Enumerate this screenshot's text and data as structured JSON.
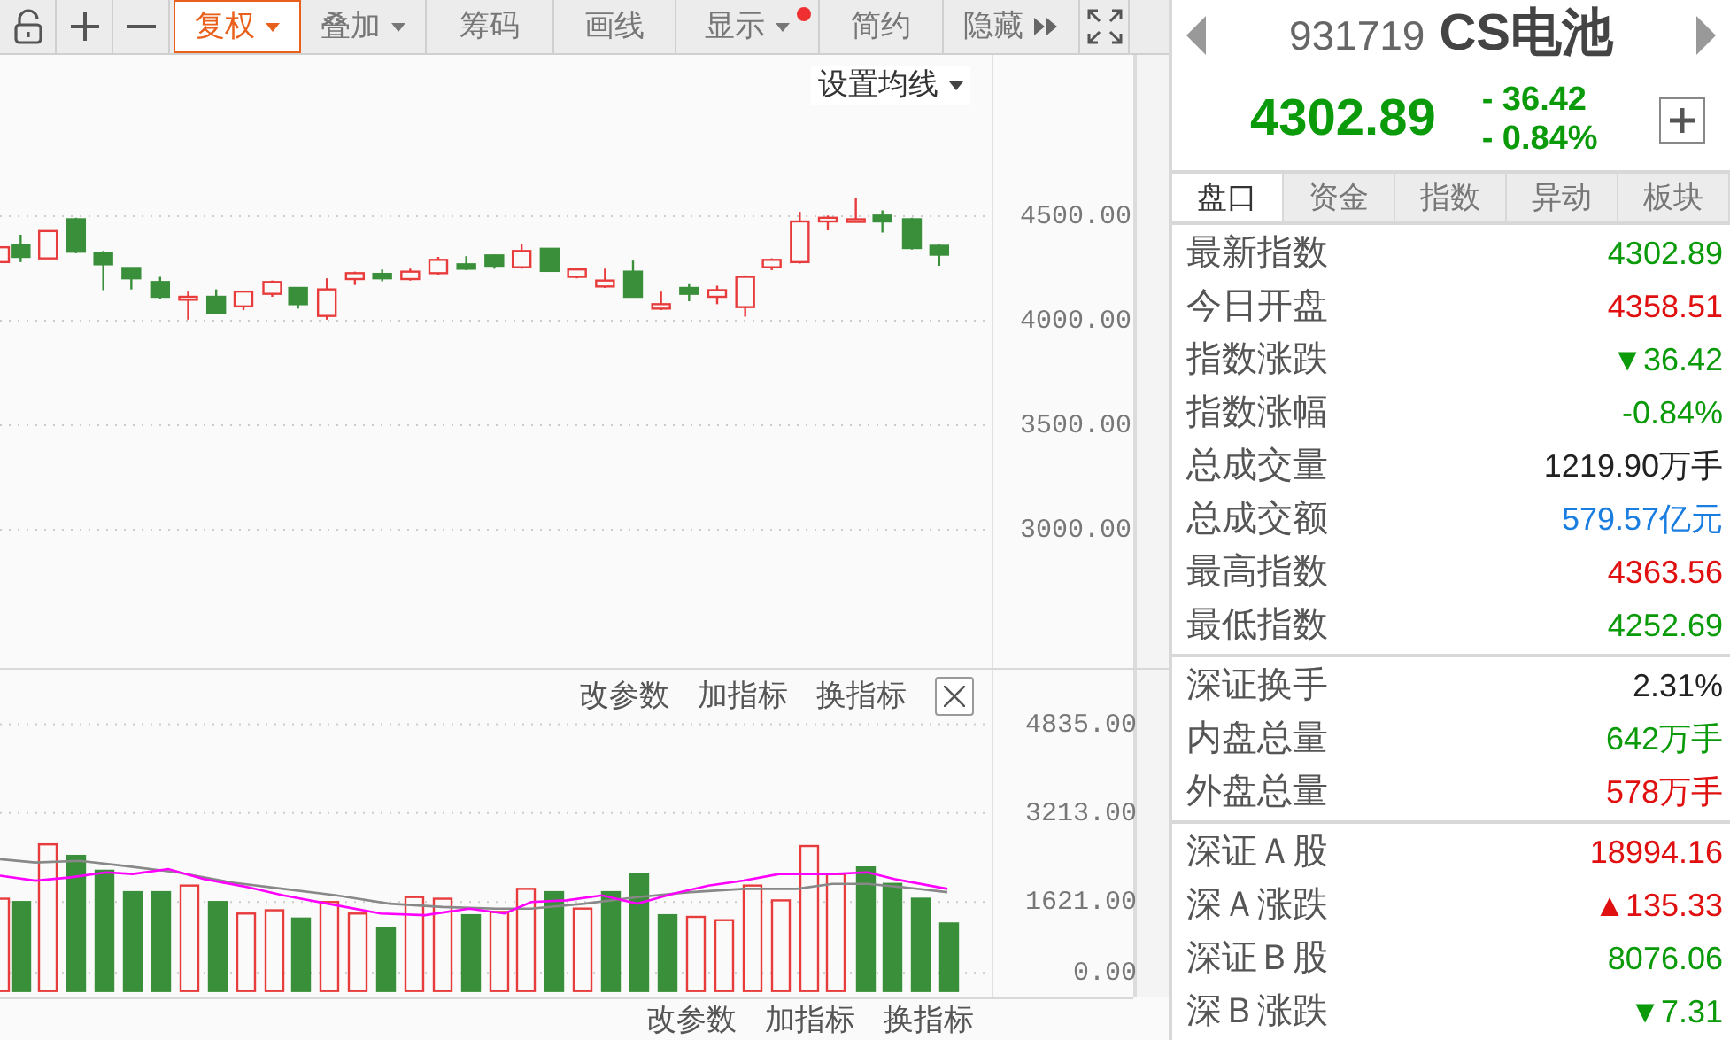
{
  "toolbar": {
    "buttons": [
      {
        "kind": "text",
        "label": "复权",
        "selected": true,
        "dropdown": true,
        "dot": false
      },
      {
        "kind": "text",
        "label": "叠加",
        "selected": false,
        "dropdown": true,
        "dot": false
      },
      {
        "kind": "text",
        "label": "筹码",
        "selected": false,
        "dropdown": false,
        "dot": false
      },
      {
        "kind": "text",
        "label": "画线",
        "selected": false,
        "dropdown": false,
        "dot": false
      },
      {
        "kind": "text",
        "label": "显示",
        "selected": false,
        "dropdown": true,
        "dot": true
      },
      {
        "kind": "text",
        "label": "简约",
        "selected": false,
        "dropdown": false,
        "dot": false
      },
      {
        "kind": "more",
        "label": "隐藏",
        "selected": false,
        "dropdown": false,
        "dot": false
      }
    ]
  },
  "price_chart": {
    "ma_setting": "设置均线",
    "axis_labels": [
      "4500.00",
      "4000.00",
      "3500.00",
      "3000.00"
    ]
  },
  "volume_chart": {
    "actions": [
      "改参数",
      "加指标",
      "换指标"
    ],
    "axis_labels": [
      "4835.00",
      "3213.00",
      "1621.00",
      "0.00"
    ]
  },
  "next_indicator": {
    "actions": [
      "改参数",
      "加指标",
      "换指标"
    ]
  },
  "quote": {
    "code": "931719",
    "name": "CS电池",
    "price": "4302.89",
    "change": "- 36.42",
    "change_pct": "- 0.84%",
    "color": "#0a9a0a"
  },
  "tabs": [
    {
      "label": "盘口",
      "selected": true
    },
    {
      "label": "资金",
      "selected": false
    },
    {
      "label": "指数",
      "selected": false
    },
    {
      "label": "异动",
      "selected": false
    },
    {
      "label": "板块",
      "selected": false
    }
  ],
  "stat_groups": [
    [
      {
        "label": "最新指数",
        "value": "4302.89",
        "color": "#0a9a0a"
      },
      {
        "label": "今日开盘",
        "value": "4358.51",
        "color": "#e01010"
      },
      {
        "label": "指数涨跌",
        "value": "▼36.42",
        "color": "#0a9a0a"
      },
      {
        "label": "指数涨幅",
        "value": "-0.84%",
        "color": "#0a9a0a"
      },
      {
        "label": "总成交量",
        "value": "1219.90万手",
        "color": "#222222"
      },
      {
        "label": "总成交额",
        "value": "579.57亿元",
        "color": "#1a7ee0"
      },
      {
        "label": "最高指数",
        "value": "4363.56",
        "color": "#e01010"
      },
      {
        "label": "最低指数",
        "value": "4252.69",
        "color": "#0a9a0a"
      }
    ],
    [
      {
        "label": "深证换手",
        "value": "2.31%",
        "color": "#222222"
      },
      {
        "label": "内盘总量",
        "value": "642万手",
        "color": "#0a9a0a"
      },
      {
        "label": "外盘总量",
        "value": "578万手",
        "color": "#e01010"
      }
    ],
    [
      {
        "label": "深证Ａ股",
        "value": "18994.16",
        "color": "#e01010"
      },
      {
        "label": "深Ａ涨跌",
        "value": "▲135.33",
        "color": "#e01010"
      },
      {
        "label": "深证Ｂ股",
        "value": "8076.06",
        "color": "#0a9a0a"
      },
      {
        "label": "深Ｂ涨跌",
        "value": "▼7.31",
        "color": "#0a9a0a"
      }
    ]
  ]
}
